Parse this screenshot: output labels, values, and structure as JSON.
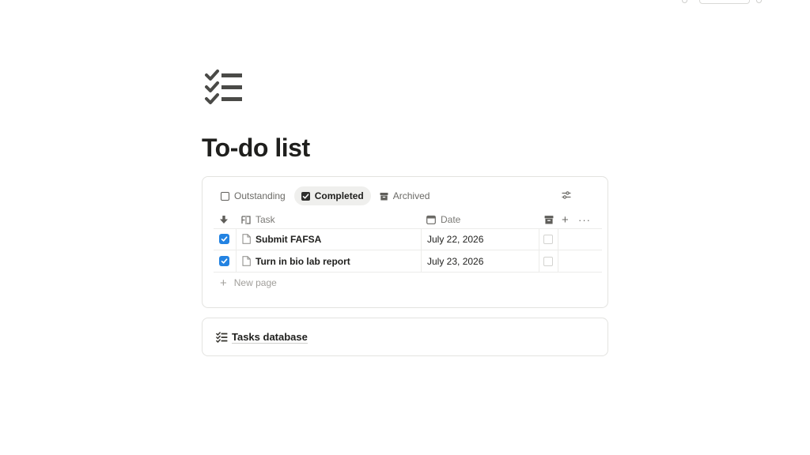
{
  "page": {
    "title": "To-do list",
    "icon": "checklist-icon"
  },
  "database": {
    "tabs": [
      {
        "label": "Outstanding",
        "icon": "checkbox-empty-icon",
        "active": false
      },
      {
        "label": "Completed",
        "icon": "checkbox-checked-icon",
        "active": true
      },
      {
        "label": "Archived",
        "icon": "archive-icon",
        "active": false
      }
    ],
    "columns": {
      "task": "Task",
      "date": "Date"
    },
    "rows": [
      {
        "task": "Submit FAFSA",
        "date": "July 22, 2026",
        "done": true,
        "archived": false
      },
      {
        "task": "Turn in bio lab report",
        "date": "July 23, 2026",
        "done": true,
        "archived": false
      }
    ],
    "new_page_label": "New page"
  },
  "linked_database": {
    "label": "Tasks database",
    "icon": "checklist-icon"
  },
  "colors": {
    "checkbox_checked": "#2383e2",
    "text_primary": "#1f1f1d",
    "text_muted": "#7a7975"
  }
}
